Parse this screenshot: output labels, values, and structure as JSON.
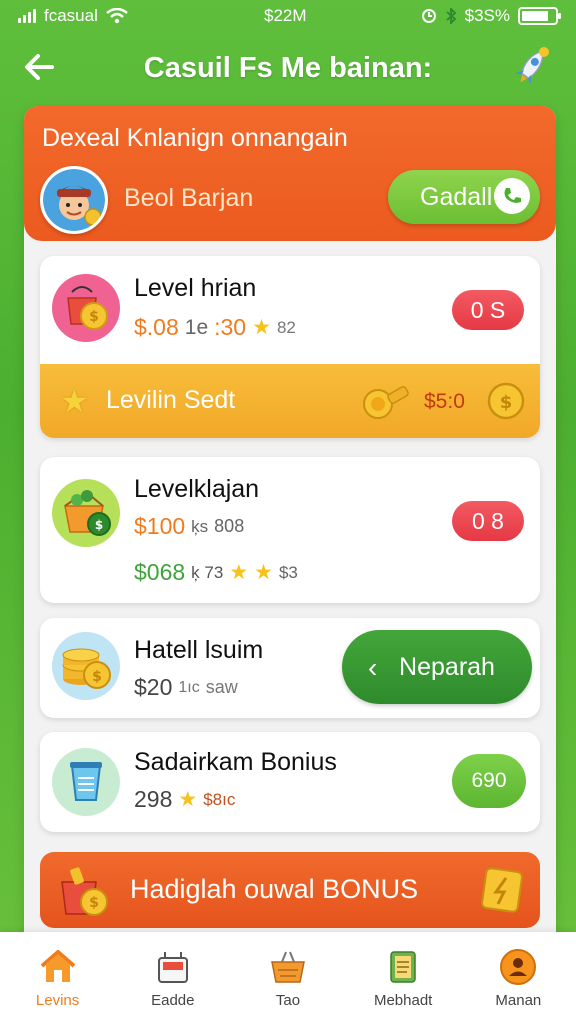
{
  "status": {
    "carrier": "fcasual",
    "time": "$22M",
    "battery": "$3S%"
  },
  "header": {
    "title": "Casuil Fs Me bainan:"
  },
  "banner": {
    "title": "Dexeal Knlanign onnangain",
    "name": "Beol Barjan",
    "button": "Gadall"
  },
  "cards": [
    {
      "title": "Level hrian",
      "amount": "$.08",
      "meta1": "1e",
      "meta2": ":30",
      "meta3": "82",
      "badge": "0 S",
      "strip_label": "Levilin Sedt",
      "strip_value": "$5:0"
    },
    {
      "title": "Levelklajan",
      "amount": "$100",
      "meta1": "ķs",
      "meta2": "808",
      "badge": "0 8",
      "amount2": "$068",
      "meta3": "ķ 73",
      "meta4": "$3"
    },
    {
      "title": "Hatell lsuim",
      "amount": "$20",
      "meta1": "1ıc",
      "meta2": "saw",
      "button": "Neparah"
    },
    {
      "title": "Sadairkam Bonius",
      "amount": "298",
      "meta1": "$8ıc",
      "badge": "690"
    }
  ],
  "bonus": {
    "label": "Hadiglah ouwal BONUS"
  },
  "tabs": [
    {
      "label": "Levins",
      "icon": "home-icon",
      "active": true
    },
    {
      "label": "Eadde",
      "icon": "tray-icon",
      "active": false
    },
    {
      "label": "Tao",
      "icon": "basket-icon",
      "active": false
    },
    {
      "label": "Mebhadt",
      "icon": "clipboard-icon",
      "active": false
    },
    {
      "label": "Manan",
      "icon": "profile-icon",
      "active": false
    }
  ],
  "colors": {
    "green": "#4caf2f",
    "orange": "#ec5a1f",
    "gold": "#f2a829",
    "red": "#e53945"
  }
}
